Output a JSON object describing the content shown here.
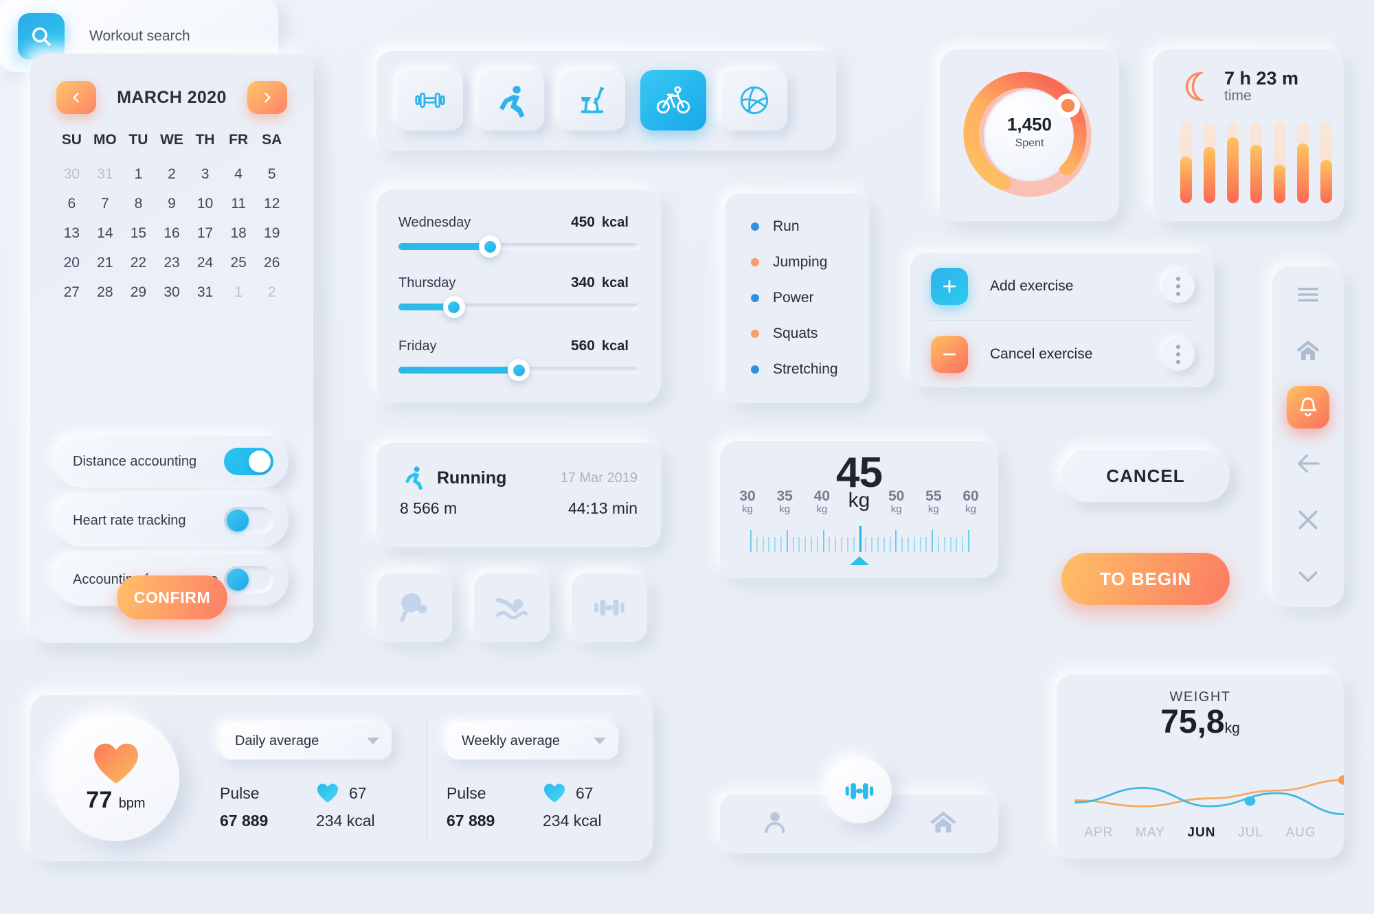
{
  "calendar": {
    "title": "MARCH 2020",
    "prev_icon": "chevron-left-icon",
    "next_icon": "chevron-right-icon",
    "dow": [
      "SU",
      "MO",
      "TU",
      "WE",
      "TH",
      "FR",
      "SA"
    ],
    "weeks": [
      [
        {
          "d": "30",
          "m": true
        },
        {
          "d": "31",
          "m": true
        },
        {
          "d": "1",
          "m": false
        },
        {
          "d": "2",
          "m": false
        },
        {
          "d": "3",
          "m": false
        },
        {
          "d": "4",
          "m": false
        },
        {
          "d": "5",
          "m": false
        }
      ],
      [
        {
          "d": "6",
          "m": false
        },
        {
          "d": "7",
          "m": false
        },
        {
          "d": "8",
          "m": false
        },
        {
          "d": "9",
          "m": false
        },
        {
          "d": "10",
          "m": false
        },
        {
          "d": "11",
          "m": false
        },
        {
          "d": "12",
          "m": false
        }
      ],
      [
        {
          "d": "13",
          "m": false
        },
        {
          "d": "14",
          "m": false
        },
        {
          "d": "15",
          "m": false
        },
        {
          "d": "16",
          "m": false
        },
        {
          "d": "17",
          "m": false
        },
        {
          "d": "18",
          "m": false
        },
        {
          "d": "19",
          "m": false
        }
      ],
      [
        {
          "d": "20",
          "m": false
        },
        {
          "d": "21",
          "m": false
        },
        {
          "d": "22",
          "m": false
        },
        {
          "d": "23",
          "m": false
        },
        {
          "d": "24",
          "m": false
        },
        {
          "d": "25",
          "m": false
        },
        {
          "d": "26",
          "m": false
        }
      ],
      [
        {
          "d": "27",
          "m": false
        },
        {
          "d": "28",
          "m": false
        },
        {
          "d": "29",
          "m": false
        },
        {
          "d": "30",
          "m": false
        },
        {
          "d": "31",
          "m": false
        },
        {
          "d": "1",
          "m": true
        },
        {
          "d": "2",
          "m": true
        }
      ]
    ],
    "toggles": [
      {
        "label": "Distance accounting",
        "on": true
      },
      {
        "label": "Heart rate tracking",
        "on": false
      },
      {
        "label": "Accounting for pressure",
        "on": false
      }
    ],
    "confirm_label": "CONFIRM"
  },
  "sport_tabs": [
    {
      "icon": "dumbbell-icon",
      "active": false
    },
    {
      "icon": "running-icon",
      "active": false
    },
    {
      "icon": "exercise-bike-icon",
      "active": false
    },
    {
      "icon": "cycling-icon",
      "active": true
    },
    {
      "icon": "volleyball-icon",
      "active": false
    }
  ],
  "kcal": {
    "unit": "kcal",
    "items": [
      {
        "day": "Wednesday",
        "value": "450",
        "pct": 38
      },
      {
        "day": "Thursday",
        "value": "340",
        "pct": 23
      },
      {
        "day": "Friday",
        "value": "560",
        "pct": 50
      }
    ]
  },
  "running": {
    "icon": "running-icon",
    "name": "Running",
    "date": "17 Mar 2019",
    "distance": "8 566 m",
    "duration": "44:13 min"
  },
  "sport_tiles": [
    {
      "icon": "table-tennis-icon"
    },
    {
      "icon": "swimming-icon"
    },
    {
      "icon": "dumbbell-icon"
    }
  ],
  "bullets": [
    {
      "label": "Run",
      "color": "#2f8fe0"
    },
    {
      "label": "Jumping",
      "color": "#f79e6e"
    },
    {
      "label": "Power",
      "color": "#2f8fe0"
    },
    {
      "label": "Squats",
      "color": "#f79e6e"
    },
    {
      "label": "Stretching",
      "color": "#2f8fe0"
    }
  ],
  "donut": {
    "value": "1,450",
    "caption": "Spent",
    "percent": 62,
    "color_start": "#ffc063",
    "color_end": "#fa6f5c",
    "track_color": "#fbc0b4"
  },
  "sleep": {
    "icon": "moon-icon",
    "time": "7 h 23 m",
    "label": "time",
    "bars": [
      58,
      70,
      82,
      72,
      48,
      74,
      54
    ]
  },
  "exercise_menu": {
    "rows": [
      {
        "icon": "plus-icon",
        "label": "Add exercise",
        "kind": "add"
      },
      {
        "icon": "minus-icon",
        "label": "Cancel exercise",
        "kind": "cancel"
      }
    ],
    "more_icon": "kebab-menu-icon"
  },
  "weight_scale": {
    "value": "45",
    "unit": "kg",
    "ticks": [
      {
        "n": "30",
        "u": "kg"
      },
      {
        "n": "35",
        "u": "kg"
      },
      {
        "n": "40",
        "u": "kg"
      },
      {
        "n": "45",
        "u": "kg"
      },
      {
        "n": "50",
        "u": "kg"
      },
      {
        "n": "55",
        "u": "kg"
      },
      {
        "n": "60",
        "u": "kg"
      }
    ]
  },
  "actions": {
    "cancel_label": "CANCEL",
    "begin_label": "TO BEGIN"
  },
  "sidebar": [
    {
      "icon": "hamburger-menu-icon",
      "active": false
    },
    {
      "icon": "home-icon",
      "active": false
    },
    {
      "icon": "bell-icon",
      "active": true
    },
    {
      "icon": "arrow-left-icon",
      "active": false
    },
    {
      "icon": "close-x-icon",
      "active": false
    },
    {
      "icon": "chevron-down-icon",
      "active": false
    }
  ],
  "search": {
    "icon": "search-icon",
    "placeholder": "Workout search"
  },
  "bottom_nav": {
    "left_icon": "user-icon",
    "center_icon": "dumbbell-icon",
    "right_icon": "home-icon"
  },
  "pulse": {
    "heart_icon": "heart-icon",
    "bpm_value": "77",
    "bpm_unit": "bpm",
    "panels": [
      {
        "dropdown": "Daily average",
        "pulse_label": "Pulse",
        "mini_heart_value": "67",
        "pulse_value": "67 889",
        "kcal_value": "234 kcal"
      },
      {
        "dropdown": "Weekly average",
        "pulse_label": "Pulse",
        "mini_heart_value": "67",
        "pulse_value": "67 889",
        "kcal_value": "234 kcal"
      }
    ]
  },
  "chart_data": {
    "type": "line",
    "title": "WEIGHT",
    "value_label": "75,8",
    "value_unit": "kg",
    "categories": [
      "APR",
      "MAY",
      "JUN",
      "JUL",
      "AUG"
    ],
    "active_category": "JUN",
    "grid": false,
    "legend": "none",
    "series": [
      {
        "name": "orange",
        "color": "#f6a95f",
        "x": [
          0,
          1,
          2,
          3,
          4
        ],
        "values": [
          47,
          38,
          50,
          62,
          78
        ],
        "marker": {
          "x": 4,
          "y": 78,
          "color": "#f79a4e"
        }
      },
      {
        "name": "blue",
        "color": "#3fb8dd",
        "x": [
          0,
          1,
          2,
          3,
          4
        ],
        "values": [
          44,
          66,
          38,
          58,
          26
        ],
        "marker": {
          "x": 2.6,
          "y": 46,
          "color": "#36c1ec"
        }
      }
    ],
    "ylim": [
      0,
      100
    ]
  }
}
